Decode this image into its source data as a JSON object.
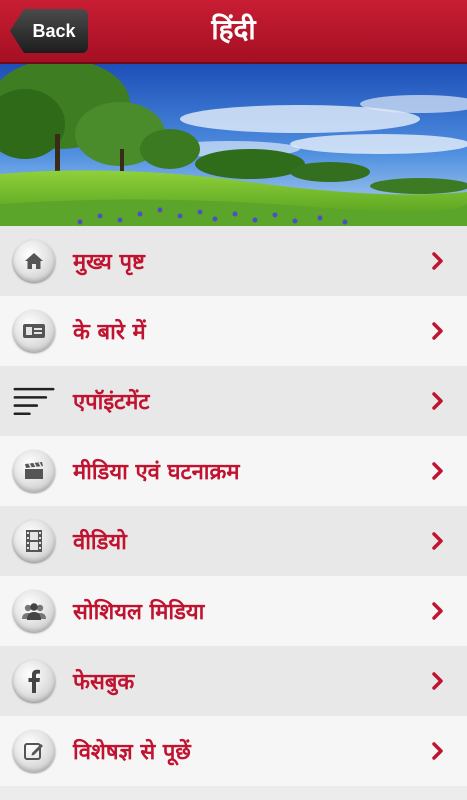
{
  "header": {
    "back_label": "Back",
    "title": "हिंदी"
  },
  "menu": {
    "items": [
      {
        "label": "मुख्य पृष्ट",
        "icon": "home-icon"
      },
      {
        "label": "के बारे में",
        "icon": "id-card-icon"
      },
      {
        "label": "एपॉइंटमेंट",
        "icon": "lines-menu-icon"
      },
      {
        "label": "मीडिया एवं घटनाक्रम",
        "icon": "clapperboard-icon"
      },
      {
        "label": "वीडियो",
        "icon": "film-strip-icon"
      },
      {
        "label": "सोशियल मिडिया",
        "icon": "people-icon"
      },
      {
        "label": "फेसबुक",
        "icon": "facebook-icon"
      },
      {
        "label": "विशेषज्ञ से पूछें",
        "icon": "edit-icon"
      }
    ]
  },
  "colors": {
    "header_red": "#b71528",
    "label_red": "#c01330",
    "back_button": "#2a2a2a"
  }
}
